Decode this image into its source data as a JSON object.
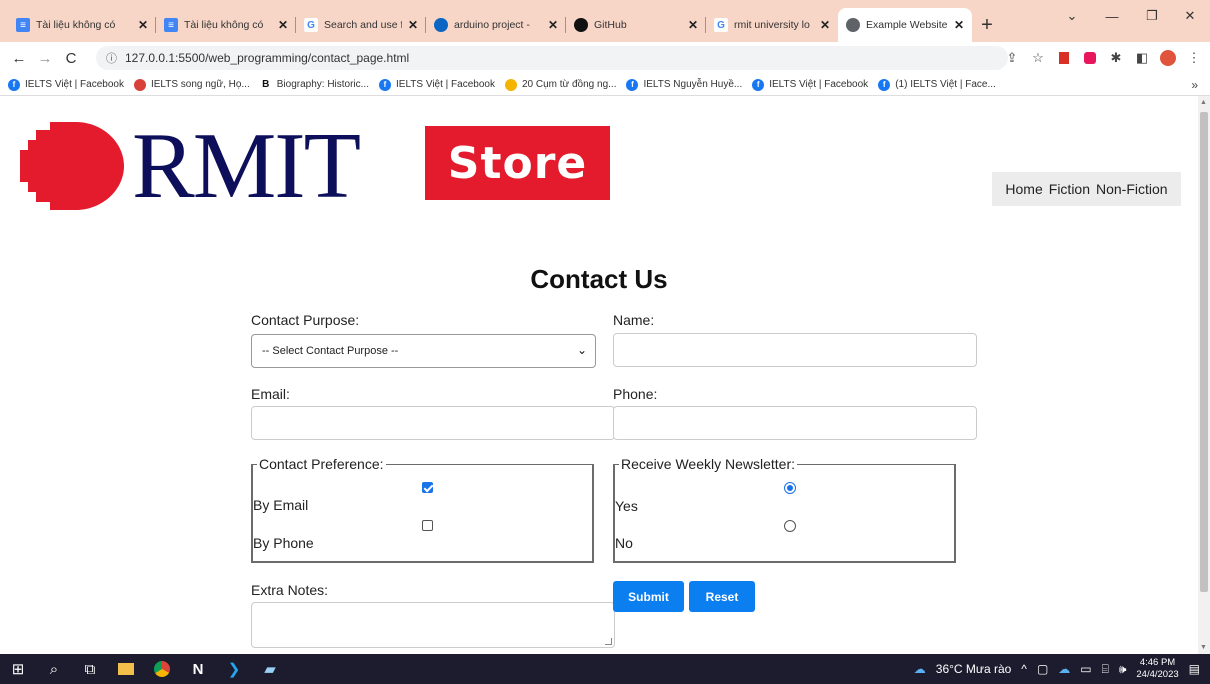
{
  "browser": {
    "tabs": [
      {
        "title": "Tài liệu không có",
        "favicon": "google-docs-icon",
        "active": false
      },
      {
        "title": "Tài liệu không có",
        "favicon": "google-docs-icon",
        "active": false
      },
      {
        "title": "Search and use fi",
        "favicon": "google-icon",
        "active": false
      },
      {
        "title": "arduino project -",
        "favicon": "onedrive-cloud-icon",
        "active": false
      },
      {
        "title": "GitHub",
        "favicon": "github-icon",
        "active": false
      },
      {
        "title": "rmit university lo",
        "favicon": "google-icon",
        "active": false
      },
      {
        "title": "Example Website",
        "favicon": "globe-icon",
        "active": true
      }
    ],
    "new_tab": "+",
    "url": "127.0.0.1:5500/web_programming/contact_page.html",
    "bookmarks": [
      {
        "label": "IELTS Việt | Facebook",
        "icon": "facebook-icon"
      },
      {
        "label": "IELTS song ngữ, Họ...",
        "icon": "ielts-icon"
      },
      {
        "label": "Biography: Historic...",
        "icon": "b-icon"
      },
      {
        "label": "IELTS Việt | Facebook",
        "icon": "facebook-icon"
      },
      {
        "label": "20 Cụm từ đồng ng...",
        "icon": "pinwheel-icon"
      },
      {
        "label": "IELTS Nguyễn Huyề...",
        "icon": "facebook-icon"
      },
      {
        "label": "IELTS Việt | Facebook",
        "icon": "facebook-icon"
      },
      {
        "label": "(1) IELTS Việt | Face...",
        "icon": "facebook-icon"
      }
    ],
    "bookmarks_more": "»"
  },
  "site": {
    "logo_word": "RMIT",
    "logo_store": "Store",
    "nav": [
      "Home",
      "Fiction",
      "Non-Fiction"
    ]
  },
  "form": {
    "heading": "Contact Us",
    "purpose_label": "Contact Purpose:",
    "purpose_value": "-- Select Contact Purpose --",
    "name_label": "Name:",
    "email_label": "Email:",
    "phone_label": "Phone:",
    "preference_legend": "Contact Preference:",
    "pref_email_label": "By Email",
    "pref_email_checked": true,
    "pref_phone_label": "By Phone",
    "pref_phone_checked": false,
    "newsletter_legend": "Receive Weekly Newsletter:",
    "newsletter_yes_label": "Yes",
    "newsletter_no_label": "No",
    "newsletter_selected": "Yes",
    "notes_label": "Extra Notes:",
    "submit_label": "Submit",
    "reset_label": "Reset",
    "accent_color": "#0b7ef0"
  },
  "taskbar": {
    "weather": "36°C Mưa rào",
    "time": "4:46 PM",
    "date": "24/4/2023"
  }
}
